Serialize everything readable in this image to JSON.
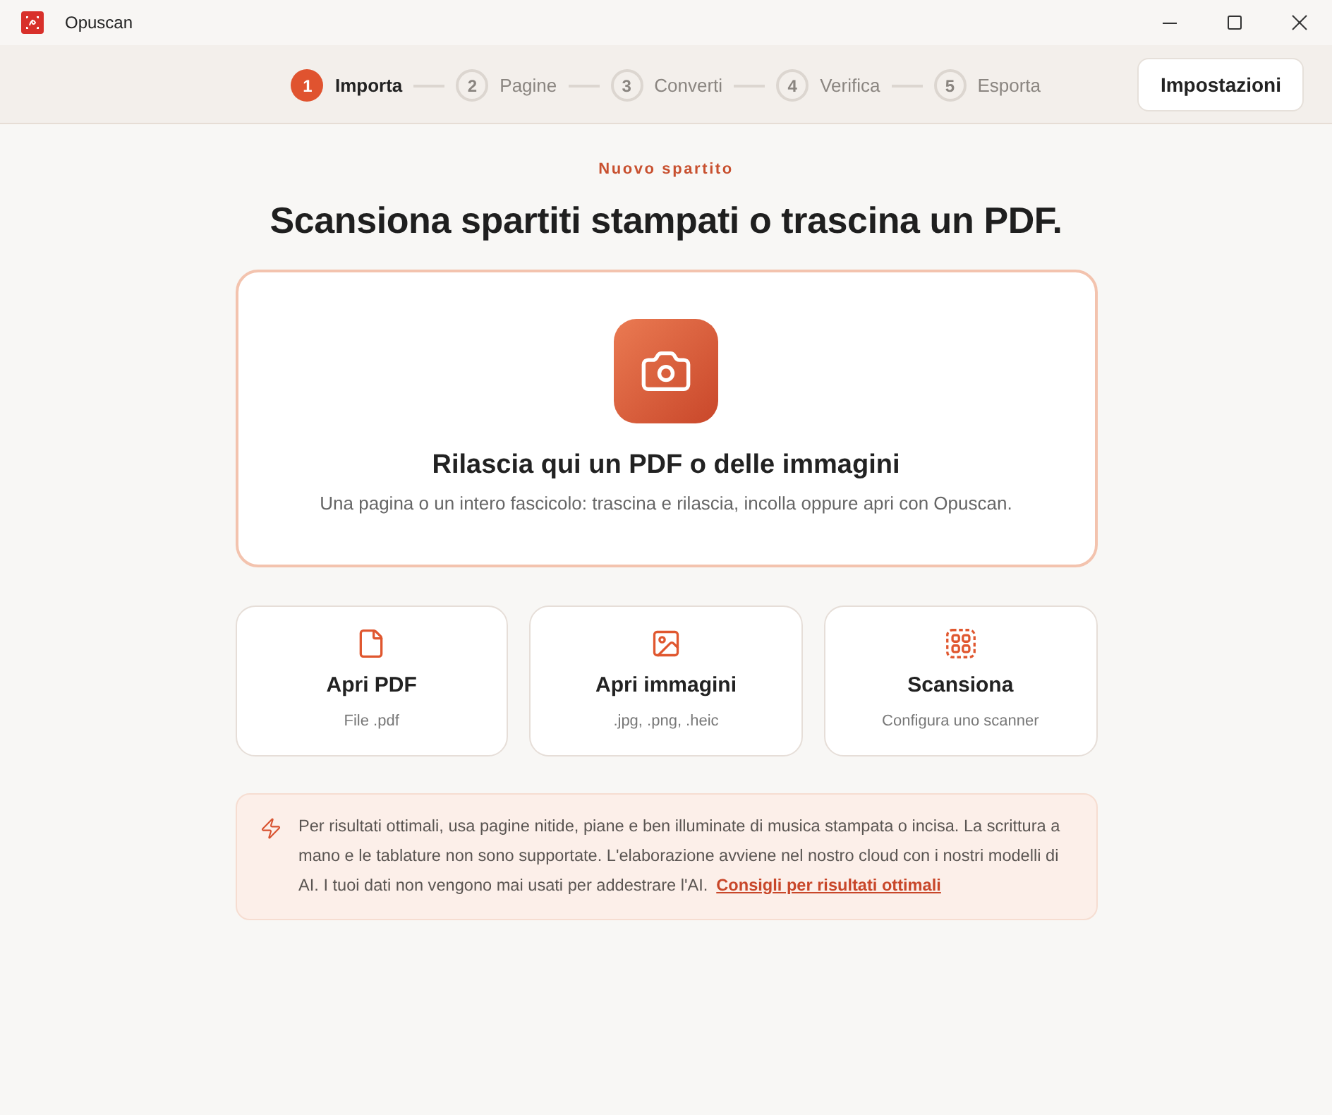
{
  "window": {
    "title": "Opuscan"
  },
  "steps": [
    {
      "number": "1",
      "label": "Importa",
      "selected": true
    },
    {
      "number": "2",
      "label": "Pagine",
      "selected": false
    },
    {
      "number": "3",
      "label": "Converti",
      "selected": false
    },
    {
      "number": "4",
      "label": "Verifica",
      "selected": false
    },
    {
      "number": "5",
      "label": "Esporta",
      "selected": false
    }
  ],
  "settings_button": "Impostazioni",
  "eyebrow": "Nuovo spartito",
  "heading": "Scansiona spartiti stampati o trascina un PDF.",
  "drop_zone": {
    "title": "Rilascia qui un PDF o delle immagini",
    "subtitle": "Una pagina o un intero fascicolo: trascina e rilascia, incolla oppure apri con Opuscan."
  },
  "actions": [
    {
      "kind": "pdf",
      "title": "Apri PDF",
      "subtitle": "File .pdf"
    },
    {
      "kind": "images",
      "title": "Apri immagini",
      "subtitle": ".jpg, .png, .heic"
    },
    {
      "kind": "scan",
      "title": "Scansiona",
      "subtitle": "Configura uno scanner"
    }
  ],
  "notice": {
    "text": "Per risultati ottimali, usa pagine nitide, piane e ben illuminate di musica stampata o incisa. La scrittura a mano e le tablature non sono supportate. L'elaborazione avviene nel nostro cloud con i nostri modelli di AI. I tuoi dati non vengono mai usati per addestrare l'AI.",
    "link": "Consigli per risultati ottimali"
  }
}
